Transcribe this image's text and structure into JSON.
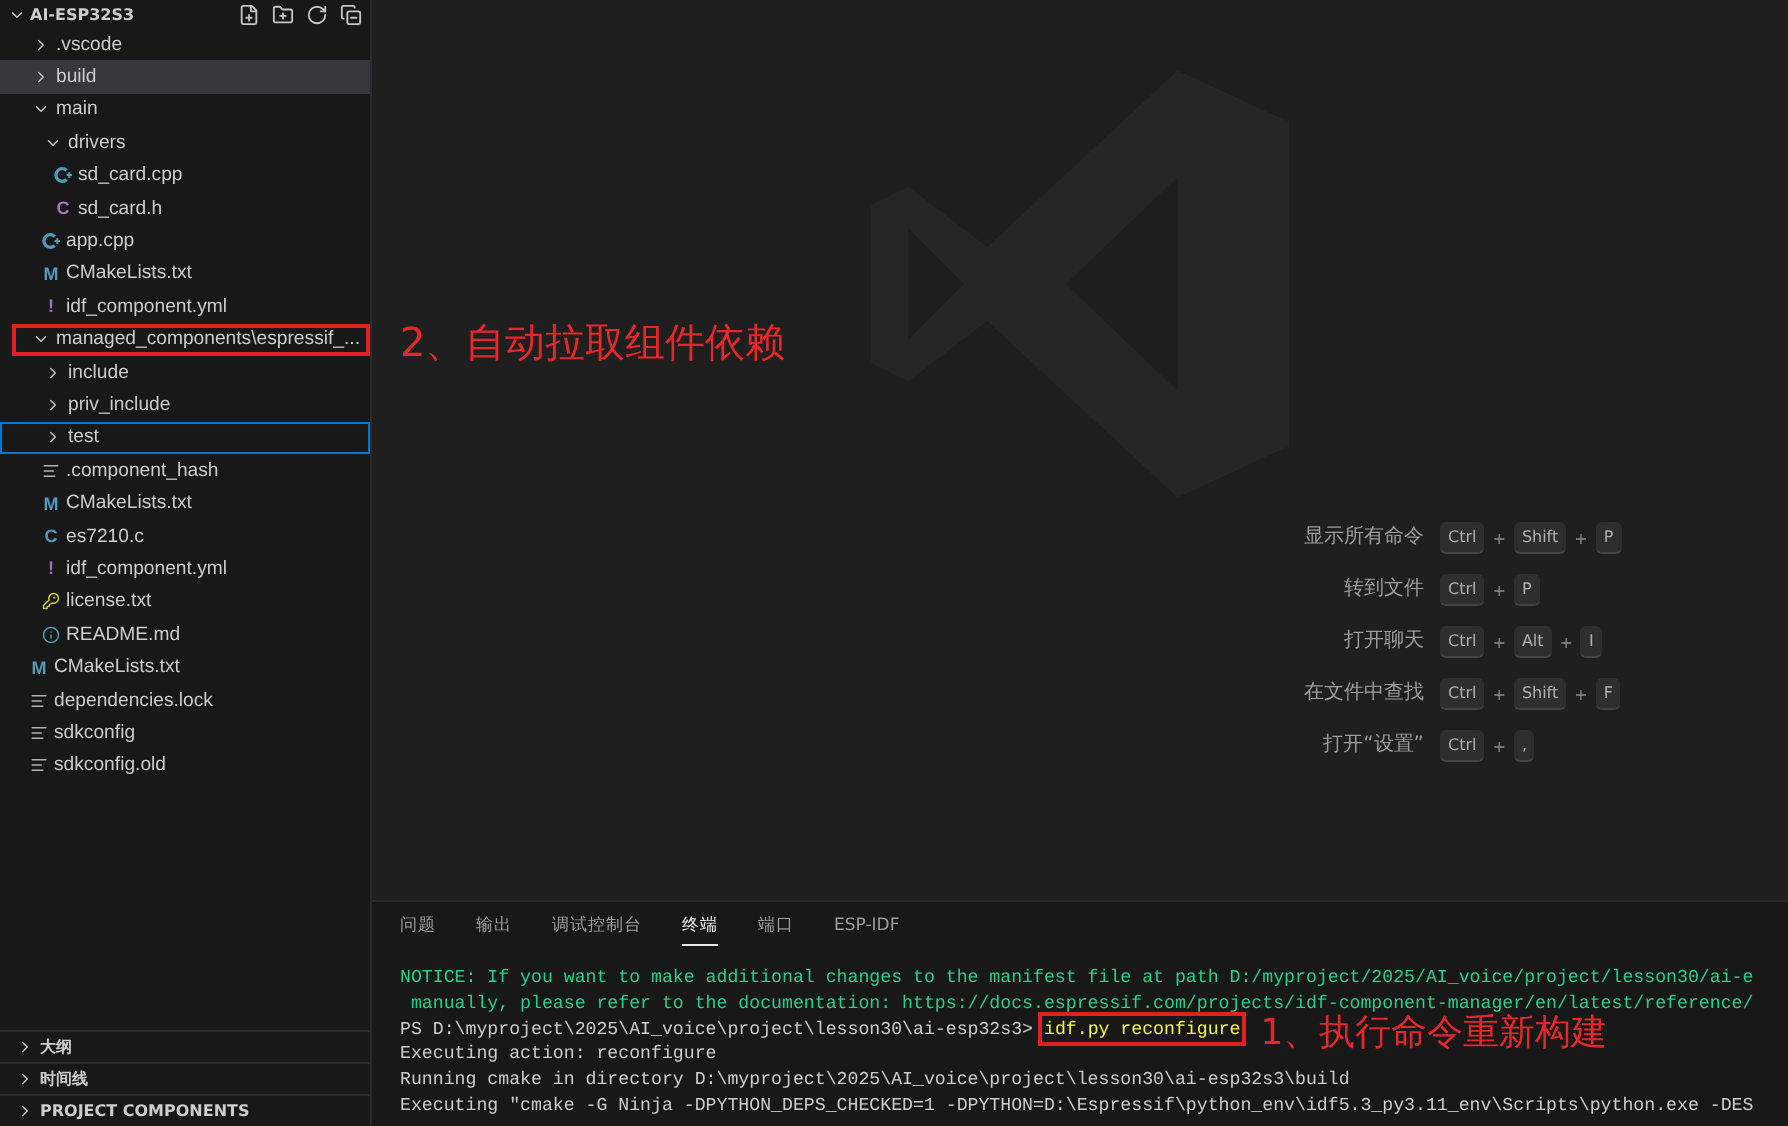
{
  "explorer": {
    "title": "AI-ESP32S3",
    "expanded": true,
    "tree": [
      {
        "name": ".vscode",
        "kind": "folder",
        "expanded": false,
        "selected": false,
        "focused": false,
        "boxed": false
      },
      {
        "name": "build",
        "kind": "folder",
        "expanded": false,
        "selected": true,
        "focused": false,
        "boxed": false
      },
      {
        "name": "main",
        "kind": "folder",
        "expanded": true,
        "selected": false,
        "focused": false,
        "boxed": false,
        "children": [
          {
            "name": "drivers",
            "kind": "folder",
            "expanded": true,
            "selected": false,
            "focused": false,
            "boxed": false,
            "children": [
              {
                "name": "sd_card.cpp",
                "kind": "cpp",
                "selected": false,
                "focused": false,
                "boxed": false
              },
              {
                "name": "sd_card.h",
                "kind": "header",
                "glyph": "C",
                "selected": false,
                "focused": false,
                "boxed": false
              }
            ]
          },
          {
            "name": "app.cpp",
            "kind": "cpp",
            "selected": false,
            "focused": false,
            "boxed": false
          },
          {
            "name": "CMakeLists.txt",
            "kind": "cmake",
            "glyph": "M",
            "selected": false,
            "focused": false,
            "boxed": false
          },
          {
            "name": "idf_component.yml",
            "kind": "yaml",
            "glyph": "!",
            "selected": false,
            "focused": false,
            "boxed": false
          }
        ]
      },
      {
        "name": "managed_components\\espressif_...",
        "kind": "folder",
        "expanded": true,
        "selected": false,
        "focused": false,
        "boxed": true,
        "children": [
          {
            "name": "include",
            "kind": "folder",
            "expanded": false,
            "selected": false,
            "focused": false,
            "boxed": false
          },
          {
            "name": "priv_include",
            "kind": "folder",
            "expanded": false,
            "selected": false,
            "focused": false,
            "boxed": false
          },
          {
            "name": "test",
            "kind": "folder",
            "expanded": false,
            "selected": false,
            "focused": true,
            "boxed": false
          },
          {
            "name": ".component_hash",
            "kind": "text",
            "selected": false,
            "focused": false,
            "boxed": false
          },
          {
            "name": "CMakeLists.txt",
            "kind": "cmake",
            "glyph": "M",
            "selected": false,
            "focused": false,
            "boxed": false
          },
          {
            "name": "es7210.c",
            "kind": "c",
            "glyph": "C",
            "selected": false,
            "focused": false,
            "boxed": false
          },
          {
            "name": "idf_component.yml",
            "kind": "yaml",
            "glyph": "!",
            "selected": false,
            "focused": false,
            "boxed": false
          },
          {
            "name": "license.txt",
            "kind": "license",
            "selected": false,
            "focused": false,
            "boxed": false
          },
          {
            "name": "README.md",
            "kind": "readme",
            "selected": false,
            "focused": false,
            "boxed": false
          }
        ]
      },
      {
        "name": "CMakeLists.txt",
        "kind": "cmake",
        "glyph": "M",
        "selected": false,
        "focused": false,
        "boxed": false
      },
      {
        "name": "dependencies.lock",
        "kind": "text",
        "selected": false,
        "focused": false,
        "boxed": false
      },
      {
        "name": "sdkconfig",
        "kind": "text",
        "selected": false,
        "focused": false,
        "boxed": false
      },
      {
        "name": "sdkconfig.old",
        "kind": "text",
        "selected": false,
        "focused": false,
        "boxed": false
      }
    ],
    "sections": [
      {
        "label": "大纲",
        "expanded": false
      },
      {
        "label": "时间线",
        "expanded": false
      },
      {
        "label": "PROJECT COMPONENTS",
        "expanded": false
      }
    ]
  },
  "tree_annotation": "2、自动拉取组件依赖",
  "shortcuts": [
    {
      "label": "显示所有命令",
      "keys": [
        "Ctrl",
        "+",
        "Shift",
        "+",
        "P"
      ]
    },
    {
      "label": "转到文件",
      "keys": [
        "Ctrl",
        "+",
        "P"
      ]
    },
    {
      "label": "打开聊天",
      "keys": [
        "Ctrl",
        "+",
        "Alt",
        "+",
        "I"
      ]
    },
    {
      "label": "在文件中查找",
      "keys": [
        "Ctrl",
        "+",
        "Shift",
        "+",
        "F"
      ]
    },
    {
      "label": "打开“设置”",
      "keys": [
        "Ctrl",
        "+",
        ","
      ]
    }
  ],
  "panel": {
    "tabs": [
      {
        "label": "问题",
        "selected": false
      },
      {
        "label": "输出",
        "selected": false
      },
      {
        "label": "调试控制台",
        "selected": false
      },
      {
        "label": "终端",
        "selected": true
      },
      {
        "label": "端口",
        "selected": false
      },
      {
        "label": "ESP-IDF",
        "selected": false
      }
    ],
    "lines": [
      {
        "kind": "notice",
        "text": "NOTICE: If you want to make additional changes to the manifest file at path D:/myproject/2025/AI_voice/project/lesson30/ai-e"
      },
      {
        "kind": "notice",
        "text": " manually, please refer to the documentation: https://docs.espressif.com/projects/idf-component-manager/en/latest/reference/"
      },
      {
        "kind": "prompt",
        "prompt": "PS D:\\myproject\\2025\\AI_voice\\project\\lesson30\\ai-esp32s3> ",
        "command": "idf.py reconfigure",
        "boxed": true,
        "annotation": "1、执行命令重新构建"
      },
      {
        "kind": "plain",
        "text": "Executing action: reconfigure"
      },
      {
        "kind": "plain",
        "text": "Running cmake in directory D:\\myproject\\2025\\AI_voice\\project\\lesson30\\ai-esp32s3\\build"
      },
      {
        "kind": "plain",
        "text": "Executing \"cmake -G Ninja -DPYTHON_DEPS_CHECKED=1 -DPYTHON=D:\\Espressif\\python_env\\idf5.3_py3.11_env\\Scripts\\python.exe -DES"
      }
    ]
  }
}
